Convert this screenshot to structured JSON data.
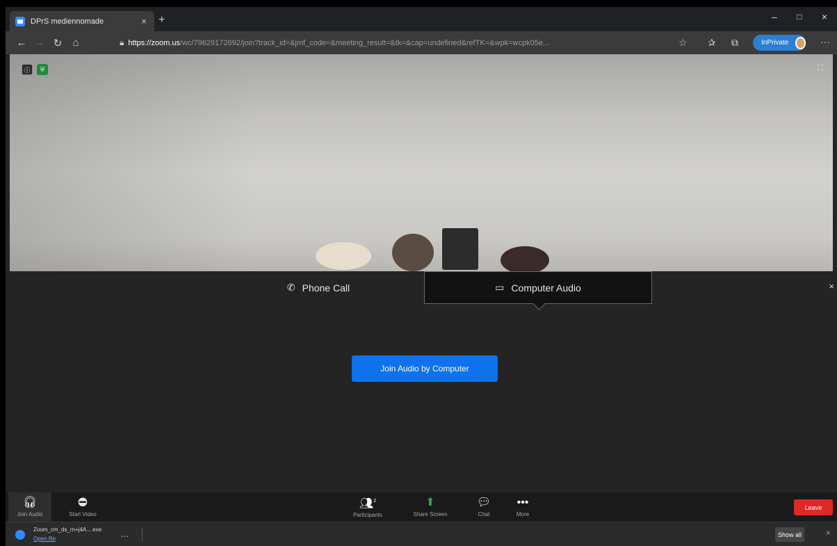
{
  "browser": {
    "tab_title": "DPrS mediennomade",
    "tab_close": "×",
    "new_tab": "+",
    "minimize": "–",
    "maximize": "□",
    "close": "×",
    "url_scheme": "https://",
    "url_host": "zoom.us",
    "url_path": "/wc/79629172692/join?track_id=&jmf_code=&meeting_result=&tk=&cap=undefined&refTK=&wpk=wcpk05e...",
    "inprivate_label": "InPrivate",
    "icons": {
      "back": "back-arrow-icon",
      "forward": "forward-arrow-icon",
      "refresh": "refresh-icon",
      "home": "home-icon",
      "lock": "lock-icon",
      "favorite": "star-icon",
      "favorites_bar": "favorites-icon",
      "collections": "collections-icon",
      "menu": "more-dots-icon"
    }
  },
  "meeting": {
    "audio_panel": {
      "tab_phone": "Phone Call",
      "tab_computer": "Computer Audio",
      "join_button": "Join Audio by Computer",
      "close": "×"
    },
    "toolbar": {
      "join_audio": "Join Audio",
      "start_video": "Start Video",
      "participants": "Participants",
      "participants_count": "2",
      "share_screen": "Share Screen",
      "chat": "Chat",
      "more": "More",
      "leave": "Leave"
    },
    "colors": {
      "primary_blue": "#0e72ed",
      "leave_red": "#e02828",
      "share_green": "#22b14c"
    }
  },
  "downloads": {
    "file_name": "Zoom_cm_ds_rn+j4A....exe",
    "open_file": "Open file",
    "more": "...",
    "show_all": "Show all",
    "close": "×"
  }
}
